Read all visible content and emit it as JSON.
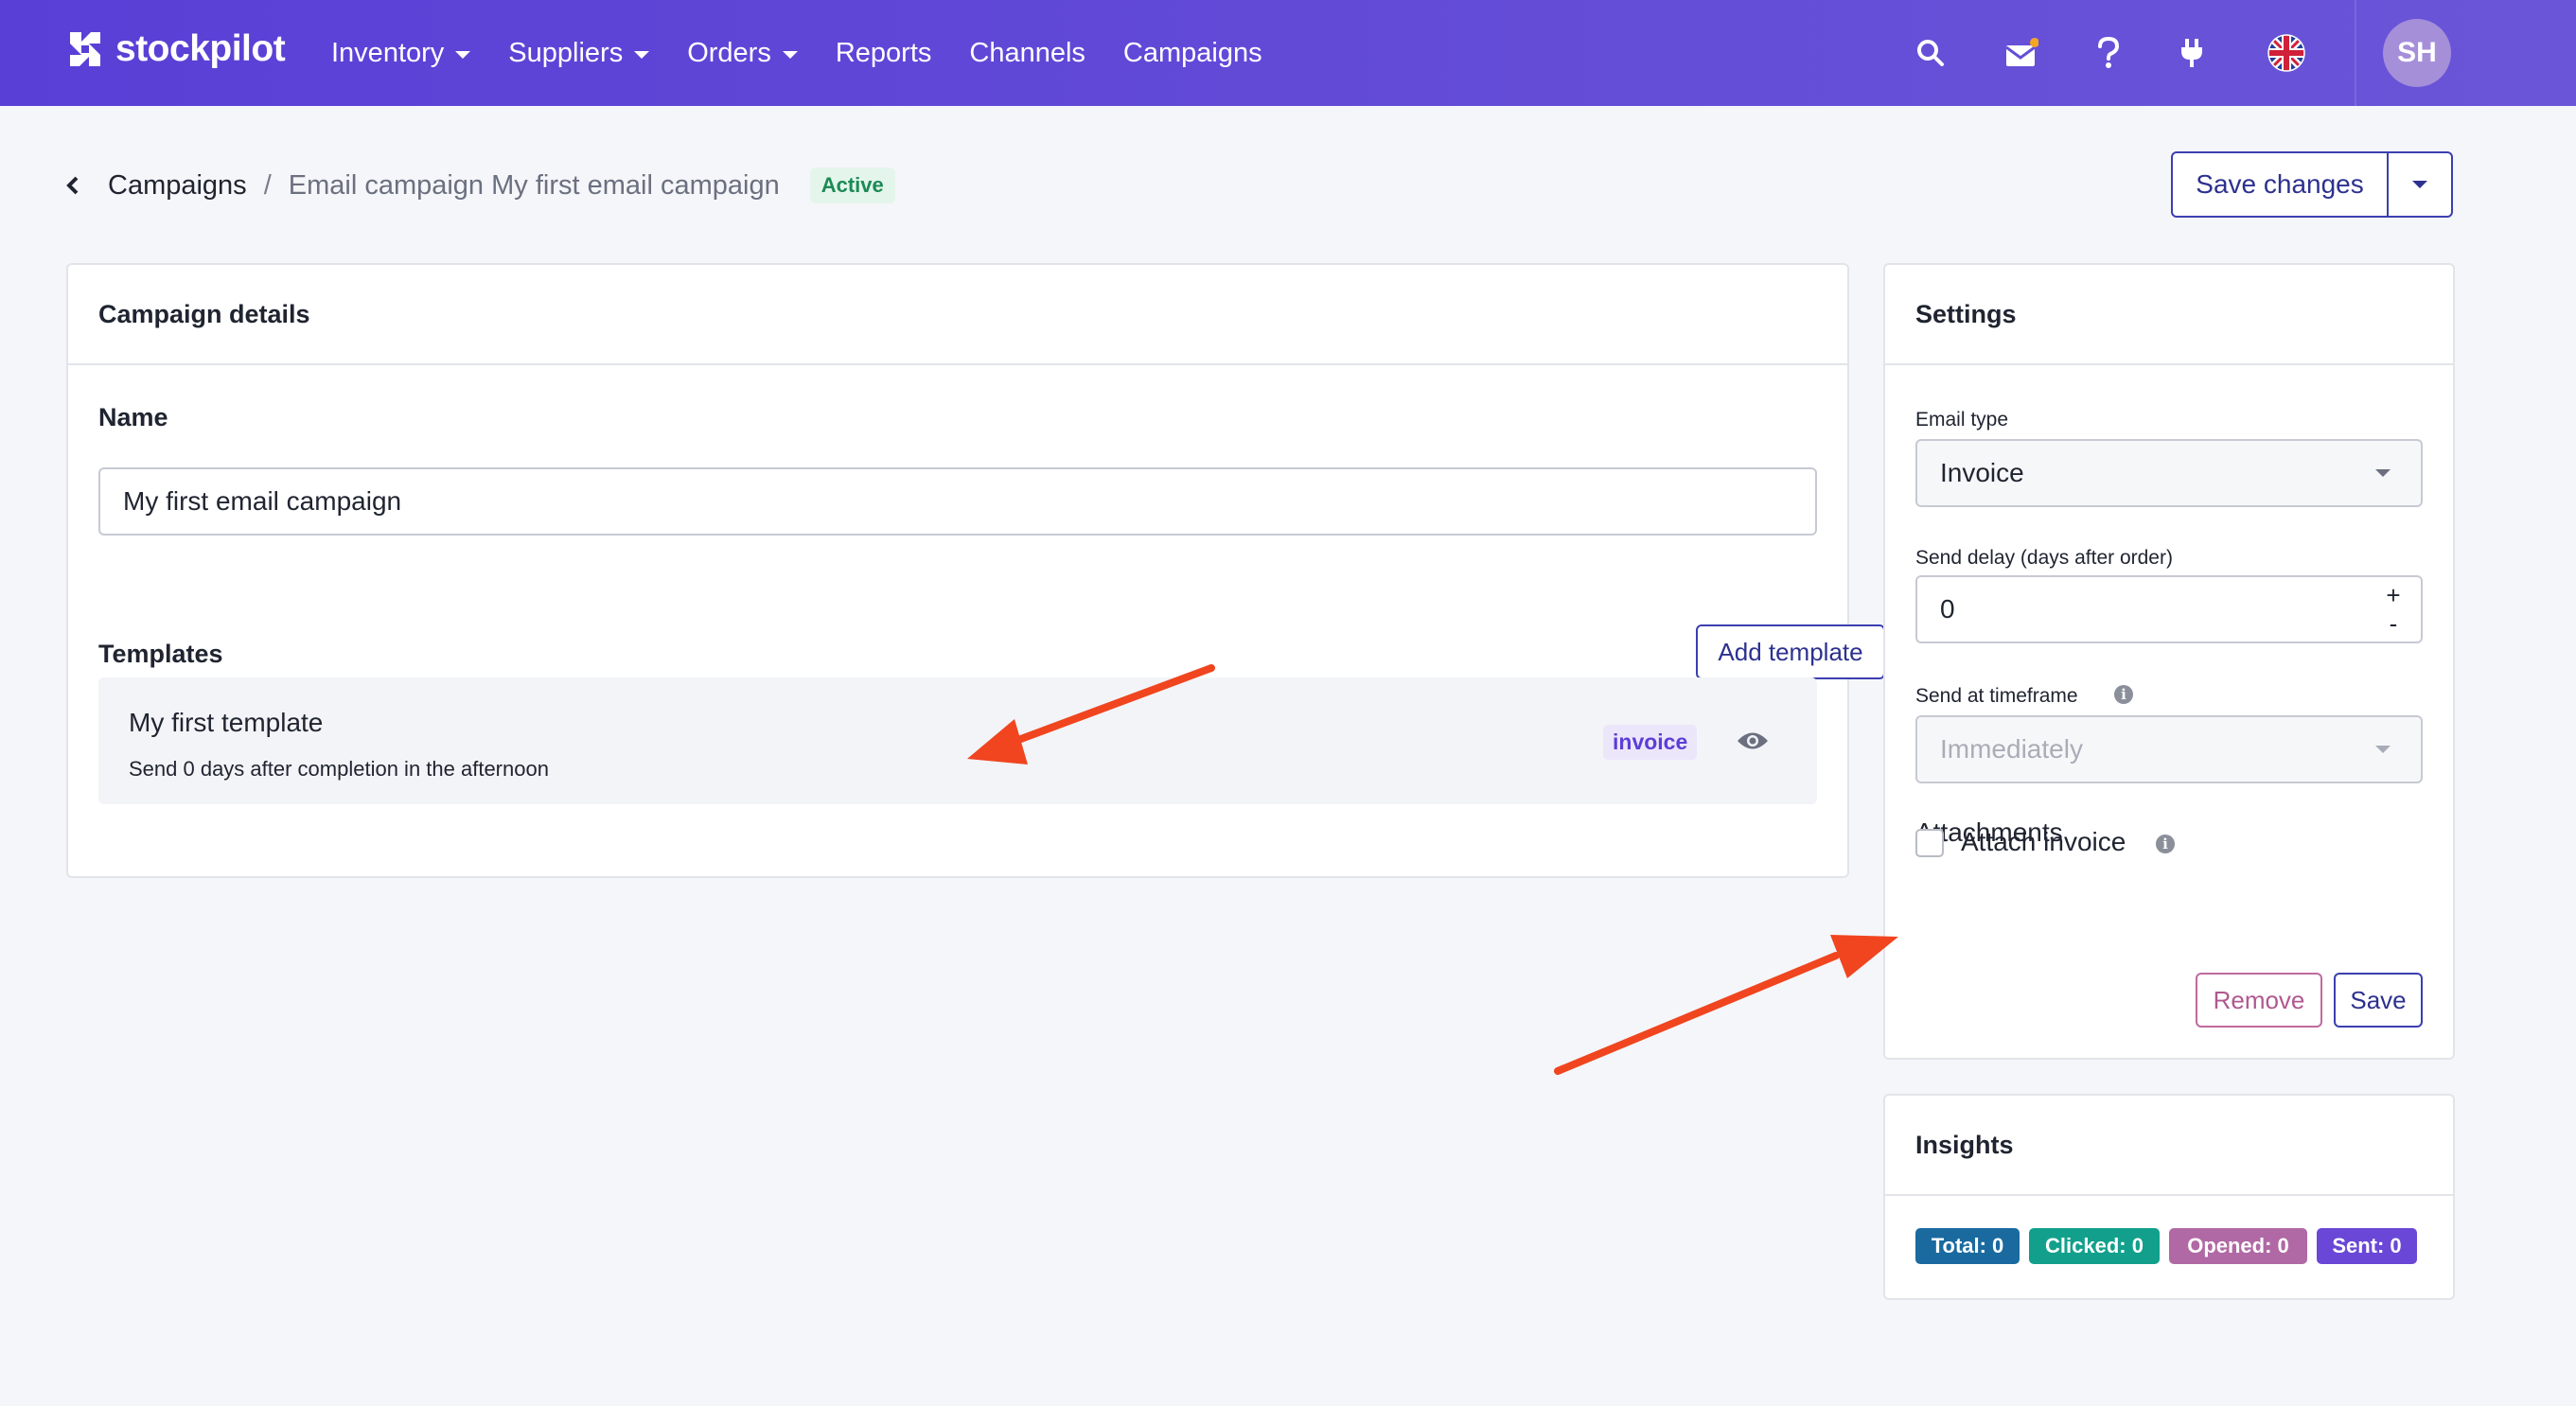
{
  "brand": {
    "name": "stockpilot"
  },
  "nav": {
    "items": [
      {
        "label": "Inventory",
        "dropdown": true
      },
      {
        "label": "Suppliers",
        "dropdown": true
      },
      {
        "label": "Orders",
        "dropdown": true
      },
      {
        "label": "Reports",
        "dropdown": false
      },
      {
        "label": "Channels",
        "dropdown": false
      },
      {
        "label": "Campaigns",
        "dropdown": false
      }
    ],
    "icons": [
      "search-icon",
      "mail-icon",
      "help-icon",
      "plug-icon",
      "uk-flag-icon"
    ],
    "avatar_initials": "SH",
    "colors": {
      "bar_start": "#5a3fd6",
      "bar_end": "#6a55d8",
      "notification_dot": "#f5a623"
    }
  },
  "breadcrumb": {
    "parent": "Campaigns",
    "separator": "/",
    "current": "Email campaign My first email campaign",
    "status": "Active"
  },
  "toolbar": {
    "save_changes_label": "Save changes"
  },
  "campaign_details": {
    "title": "Campaign details",
    "name_label": "Name",
    "name_value": "My first email campaign",
    "templates_label": "Templates",
    "add_template_label": "Add template",
    "templates": [
      {
        "title": "My first template",
        "subtitle": "Send 0 days after completion in the afternoon",
        "type_badge": "invoice"
      }
    ]
  },
  "settings": {
    "title": "Settings",
    "email_type_label": "Email type",
    "email_type_value": "Invoice",
    "send_delay_label": "Send delay (days after order)",
    "send_delay_value": "0",
    "stepper_plus": "+",
    "stepper_minus": "-",
    "timeframe_label": "Send at timeframe",
    "timeframe_value": "Immediately",
    "attachments_label": "Attachments",
    "attach_invoice_label": "Attach invoice",
    "attach_invoice_checked": false,
    "remove_label": "Remove",
    "save_label": "Save"
  },
  "insights": {
    "title": "Insights",
    "stats": [
      {
        "label": "Total: 0",
        "color": "#1a6aa0"
      },
      {
        "label": "Clicked: 0",
        "color": "#12a08c"
      },
      {
        "label": "Opened: 0",
        "color": "#b069a4"
      },
      {
        "label": "Sent: 0",
        "color": "#6a47d6"
      }
    ]
  },
  "annotations": {
    "arrow_color": "#f0451f"
  }
}
